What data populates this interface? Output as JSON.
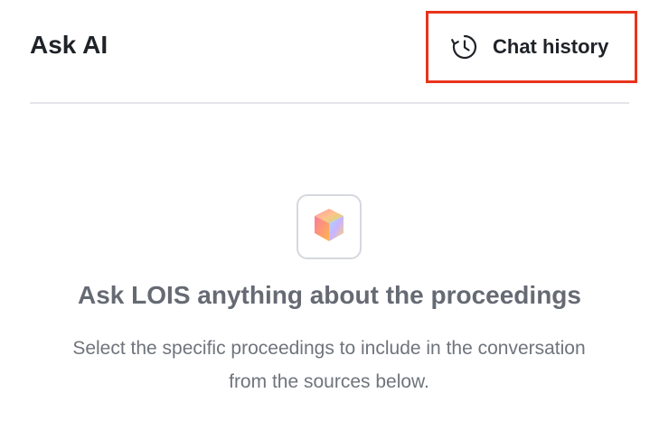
{
  "header": {
    "title": "Ask AI",
    "chat_history_label": "Chat history",
    "chat_history_icon": "clock-history-icon"
  },
  "empty_state": {
    "logo_icon": "gradient-cube-icon",
    "heading": "Ask LOIS anything about the proceedings",
    "description": "Select the specific proceedings to include in the conversation from the sources below."
  },
  "colors": {
    "highlight_border": "#e8341c",
    "divider": "#e3e5ea",
    "heading_text": "#656a73"
  }
}
